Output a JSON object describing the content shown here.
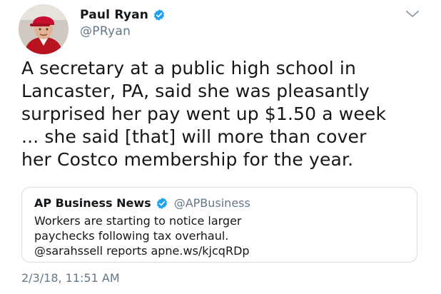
{
  "author": {
    "name": "Paul Ryan",
    "handle": "@PRyan"
  },
  "tweet": {
    "text": "A secretary at a public high school in\nLancaster, PA, said she was pleasantly\nsurprised her pay went up $1.50 a week\n... she said [that] will more than cover\nher Costco membership for the year."
  },
  "quoted_tweet": {
    "name": "AP Business News",
    "handle": "@APBusiness",
    "text": "Workers are starting to notice larger\npaychecks following tax overhaul.\n@sarahssell reports apne.ws/kjcqRDp"
  },
  "timestamp": "2/3/18, 11:51 AM",
  "icons": {
    "verified": "verified-badge-icon",
    "caret": "chevron-down-icon"
  },
  "colors": {
    "verified_blue": "#1da1f2",
    "secondary_text": "#657786",
    "primary_text": "#14171a"
  }
}
